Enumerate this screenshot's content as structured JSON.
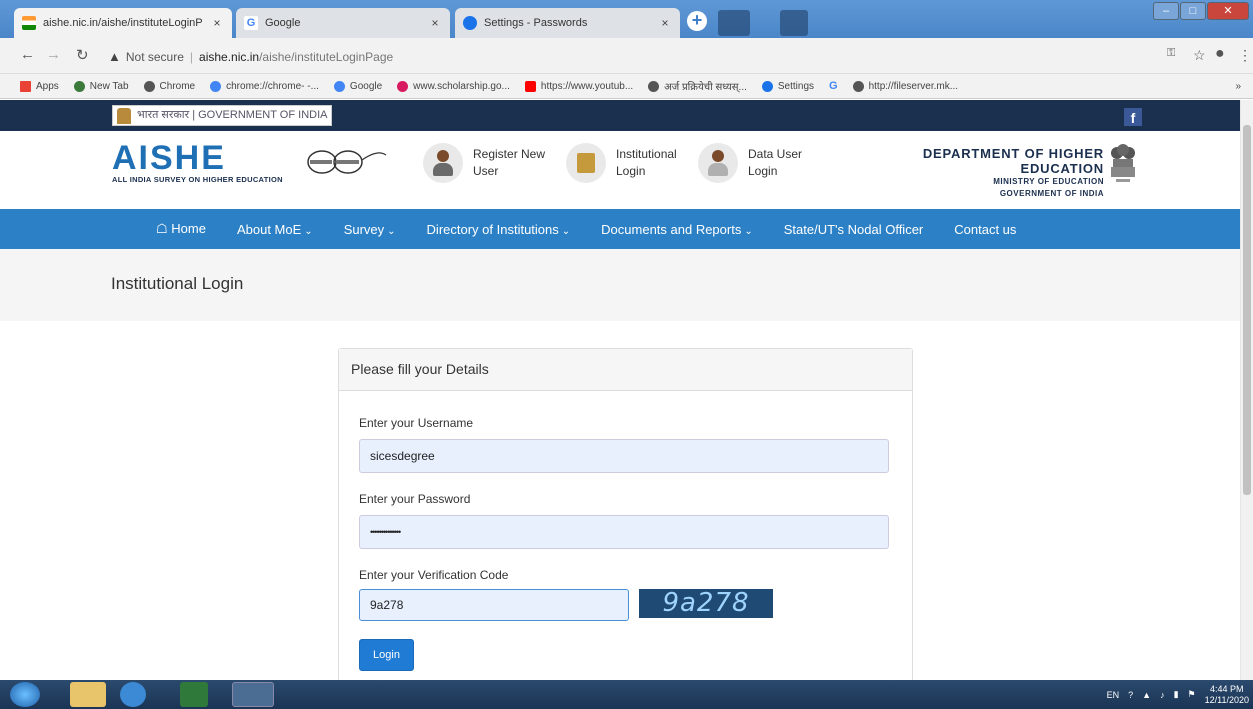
{
  "browser": {
    "tabs": [
      {
        "title": "aishe.nic.in/aishe/instituteLoginP",
        "close": "×",
        "active": true,
        "icon": "india-flag-icon"
      },
      {
        "title": "Google",
        "close": "×",
        "active": false,
        "icon": "google-icon"
      },
      {
        "title": "Settings - Passwords",
        "close": "×",
        "active": false,
        "icon": "gear-icon"
      }
    ],
    "new_tab": "+",
    "address": {
      "security_label": "Not secure",
      "separator": "|",
      "host": "aishe.nic.in",
      "path": "/aishe/instituteLoginPage"
    },
    "bookmarks": [
      {
        "label": "Apps",
        "color": "#e94235"
      },
      {
        "label": "New Tab",
        "color": "#3b7a3b"
      },
      {
        "label": "Chrome",
        "color": "#555555"
      },
      {
        "label": "chrome://chrome- -...",
        "color": "#4285f4"
      },
      {
        "label": "Google",
        "color": "#4285f4"
      },
      {
        "label": "www.scholarship.go...",
        "color": "#d81b60"
      },
      {
        "label": "https://www.youtub...",
        "color": "#ff0000"
      },
      {
        "label": "अर्ज प्रक्रियेची सध्यस्...",
        "color": "#555555"
      },
      {
        "label": "Settings",
        "color": "#1a73e8"
      },
      {
        "label": "G",
        "color": "#4285f4"
      },
      {
        "label": "http://fileserver.mk...",
        "color": "#555555"
      }
    ],
    "more_bookmarks": "»"
  },
  "site": {
    "gov_bar_text": "भारत सरकार | GOVERNMENT OF INDIA",
    "facebook": "f",
    "logo": {
      "title": "AISHE",
      "subtitle": "ALL INDIA SURVEY ON HIGHER EDUCATION"
    },
    "header_links": [
      {
        "line1": "Register New",
        "line2": "User"
      },
      {
        "line1": "Institutional",
        "line2": "Login"
      },
      {
        "line1": "Data User",
        "line2": "Login"
      }
    ],
    "department": {
      "line1": "DEPARTMENT OF HIGHER EDUCATION",
      "line2": "MINISTRY OF EDUCATION",
      "line3": "GOVERNMENT OF INDIA"
    },
    "nav": [
      {
        "label": "Home",
        "icon": "home-icon"
      },
      {
        "label": "About MoE",
        "caret": "⌄"
      },
      {
        "label": "Survey",
        "caret": "⌄"
      },
      {
        "label": "Directory of Institutions",
        "caret": "⌄"
      },
      {
        "label": "Documents and Reports",
        "caret": "⌄"
      },
      {
        "label": "State/UT's Nodal Officer"
      },
      {
        "label": "Contact us"
      }
    ],
    "page_title": "Institutional Login",
    "form": {
      "heading": "Please fill your Details",
      "username_label": "Enter your Username",
      "username_value": "sicesdegree",
      "password_label": "Enter your Password",
      "password_value": "••••••••••••••",
      "captcha_label": "Enter your Verification Code",
      "captcha_value": "9a278",
      "captcha_image_text": "9a278",
      "login_button": "Login"
    }
  },
  "taskbar": {
    "lang": "EN",
    "time": "4:44 PM",
    "date": "12/11/2020"
  }
}
